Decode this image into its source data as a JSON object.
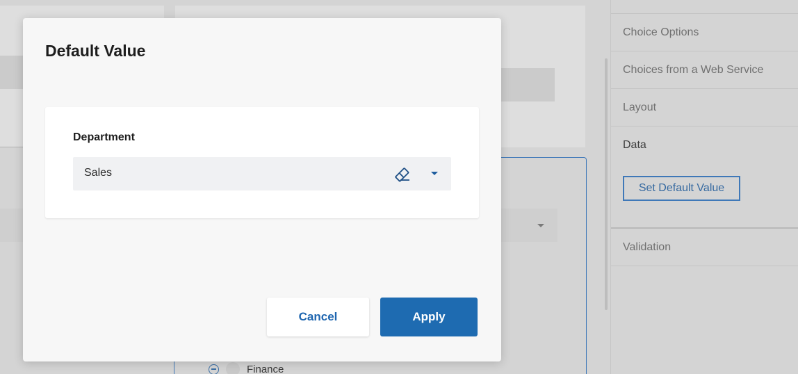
{
  "modal": {
    "title": "Default Value",
    "field_label": "Department",
    "selected_value": "Sales",
    "clear_icon": "eraser-icon",
    "dropdown_icon": "caret-down-icon",
    "cancel_label": "Cancel",
    "apply_label": "Apply"
  },
  "side_panel": {
    "items": [
      {
        "label": "Choice Options",
        "active": false
      },
      {
        "label": "Choices from a Web Service",
        "active": false
      },
      {
        "label": "Layout",
        "active": false
      },
      {
        "label": "Data",
        "active": true
      },
      {
        "label": "Validation",
        "active": false
      }
    ],
    "set_default_button": "Set Default Value"
  },
  "background": {
    "option_label": "Finance"
  },
  "colors": {
    "accent": "#1e6bb1",
    "overlay": "#d4d4d4",
    "modal_bg": "#f7f7f7"
  }
}
